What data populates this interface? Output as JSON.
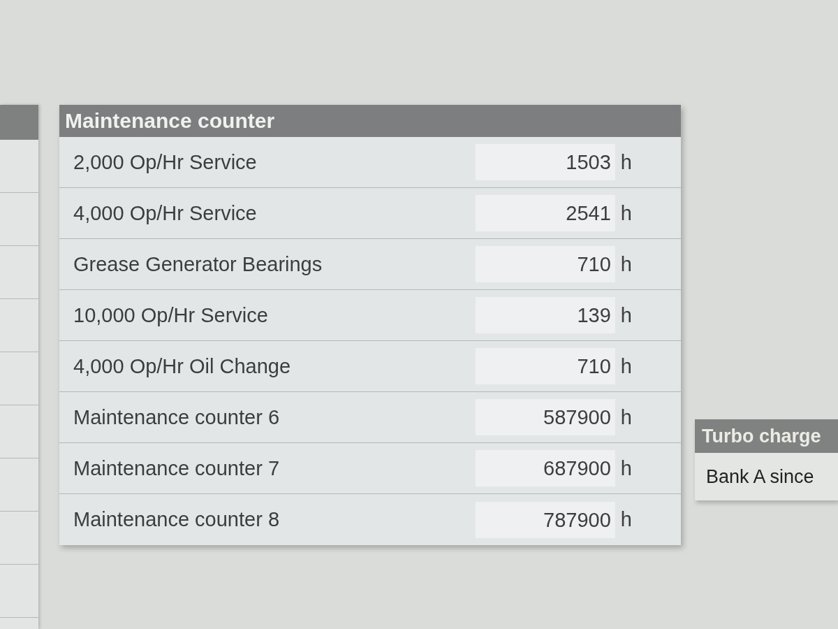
{
  "maintenance_counter": {
    "title": "Maintenance counter",
    "rows": [
      {
        "label": "2,000 Op/Hr Service",
        "value": "1503",
        "unit": "h"
      },
      {
        "label": "4,000 Op/Hr Service",
        "value": "2541",
        "unit": "h"
      },
      {
        "label": "Grease Generator Bearings",
        "value": "710",
        "unit": "h"
      },
      {
        "label": "10,000 Op/Hr Service",
        "value": "139",
        "unit": "h"
      },
      {
        "label": "4,000 Op/Hr Oil Change",
        "value": "710",
        "unit": "h"
      },
      {
        "label": "Maintenance counter 6",
        "value": "587900",
        "unit": "h"
      },
      {
        "label": "Maintenance counter 7",
        "value": "687900",
        "unit": "h"
      },
      {
        "label": "Maintenance counter 8",
        "value": "787900",
        "unit": "h"
      }
    ]
  },
  "turbo_panel": {
    "title": "Turbo charge",
    "rows": [
      {
        "label": "Bank A since"
      }
    ]
  }
}
